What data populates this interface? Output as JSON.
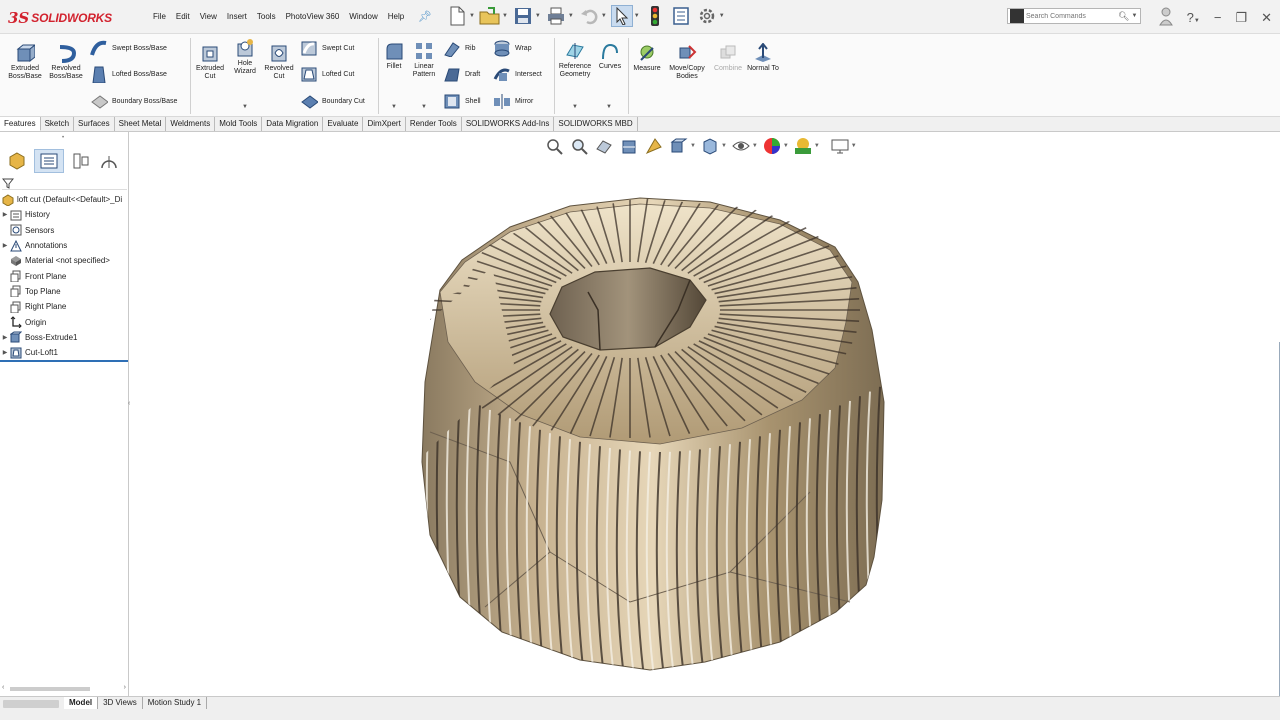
{
  "app": {
    "logo_prefix": "3S",
    "logo_text": "SOLIDWORKS"
  },
  "menu": [
    "File",
    "Edit",
    "View",
    "Insert",
    "Tools",
    "PhotoView 360",
    "Window",
    "Help"
  ],
  "search": {
    "placeholder": "Search Commands"
  },
  "command_manager": {
    "extruded_boss": "Extruded Boss/Base",
    "revolved_boss": "Revolved Boss/Base",
    "swept_boss": "Swept Boss/Base",
    "lofted_boss": "Lofted Boss/Base",
    "boundary_boss": "Boundary Boss/Base",
    "extruded_cut": "Extruded Cut",
    "hole_wizard": "Hole Wizard",
    "revolved_cut": "Revolved Cut",
    "swept_cut": "Swept Cut",
    "lofted_cut": "Lofted Cut",
    "boundary_cut": "Boundary Cut",
    "fillet": "Fillet",
    "linear_pattern": "Linear Pattern",
    "rib": "Rib",
    "draft": "Draft",
    "shell": "Shell",
    "wrap": "Wrap",
    "intersect": "Intersect",
    "mirror": "Mirror",
    "reference_geometry": "Reference Geometry",
    "curves": "Curves",
    "measure": "Measure",
    "move_copy": "Move/Copy Bodies",
    "combine": "Combine",
    "normal_to": "Normal To"
  },
  "tabs": [
    "Features",
    "Sketch",
    "Surfaces",
    "Sheet Metal",
    "Weldments",
    "Mold Tools",
    "Data Migration",
    "Evaluate",
    "DimXpert",
    "Render Tools",
    "SOLIDWORKS Add-Ins",
    "SOLIDWORKS MBD"
  ],
  "active_tab": "Features",
  "tree": {
    "root": "loft cut  (Default<<Default>_Di",
    "items": [
      {
        "label": "History",
        "expandable": true
      },
      {
        "label": "Sensors",
        "expandable": false
      },
      {
        "label": "Annotations",
        "expandable": true
      },
      {
        "label": "Material <not specified>",
        "expandable": false
      },
      {
        "label": "Front Plane",
        "expandable": false
      },
      {
        "label": "Top Plane",
        "expandable": false
      },
      {
        "label": "Right Plane",
        "expandable": false
      },
      {
        "label": "Origin",
        "expandable": false
      },
      {
        "label": "Boss-Extrude1",
        "expandable": true
      },
      {
        "label": "Cut-Loft1",
        "expandable": true
      }
    ]
  },
  "bottom_tabs": [
    "Model",
    "3D Views",
    "Motion Study 1"
  ],
  "colors": {
    "brand": "#d2222e",
    "model_body": "#b5a07e",
    "selection": "#2e6fb5"
  }
}
